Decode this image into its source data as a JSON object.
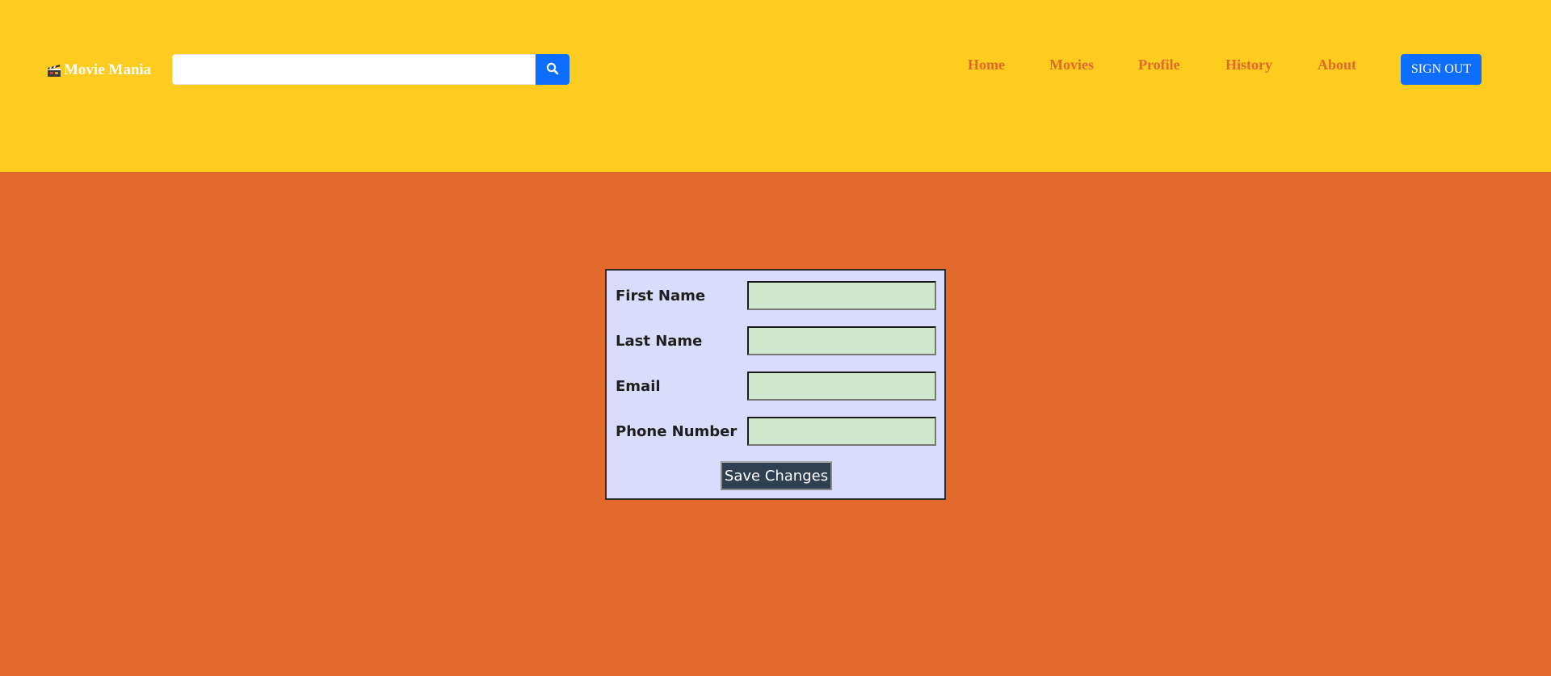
{
  "header": {
    "brand_name": "Movie Mania",
    "brand_icon": "clapperboard-icon",
    "search": {
      "value": "",
      "placeholder": ""
    },
    "search_button_icon": "search-icon",
    "nav_items": [
      {
        "label": "Home"
      },
      {
        "label": "Movies"
      },
      {
        "label": "Profile"
      },
      {
        "label": "History"
      },
      {
        "label": "About"
      }
    ],
    "sign_out_label": "SIGN OUT"
  },
  "form": {
    "fields": [
      {
        "label": "First Name",
        "value": ""
      },
      {
        "label": "Last Name",
        "value": ""
      },
      {
        "label": "Email",
        "value": ""
      },
      {
        "label": "Phone Number",
        "value": ""
      }
    ],
    "submit_label": "Save Changes"
  },
  "colors": {
    "header_background": "#fecb1f",
    "page_background": "#e1692c",
    "nav_text": "#e1692c",
    "primary_button": "#0d6efd",
    "form_background": "#dadcfb",
    "input_background": "#d1e6cf",
    "save_button": "#2e4052"
  }
}
